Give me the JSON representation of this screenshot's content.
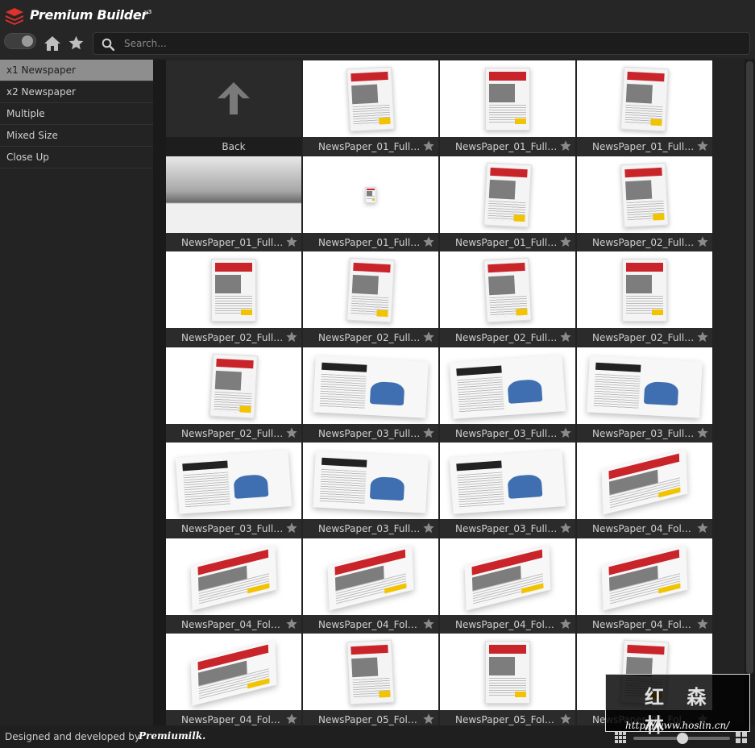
{
  "header": {
    "brand": "Premium Builder",
    "version": "v3"
  },
  "toolbar": {
    "search_placeholder": "Search..."
  },
  "sidebar": {
    "items": [
      {
        "label": "x1 Newspaper",
        "active": true
      },
      {
        "label": "x2 Newspaper",
        "active": false
      },
      {
        "label": "Multiple",
        "active": false
      },
      {
        "label": "Mixed Size",
        "active": false
      },
      {
        "label": "Close Up",
        "active": false
      }
    ]
  },
  "grid": {
    "back_label": "Back",
    "tiles": [
      {
        "label": "NewsPaper_01_FullP...",
        "style": "np"
      },
      {
        "label": "NewsPaper_01_FullP...",
        "style": "np"
      },
      {
        "label": "NewsPaper_01_FullP...",
        "style": "np"
      },
      {
        "label": "NewsPaper_01_FullP...",
        "style": "closeup"
      },
      {
        "label": "NewsPaper_01_FullP...",
        "style": "tiny"
      },
      {
        "label": "NewsPaper_01_FullP...",
        "style": "np"
      },
      {
        "label": "NewsPaper_02_FullP...",
        "style": "np"
      },
      {
        "label": "NewsPaper_02_FullP...",
        "style": "np"
      },
      {
        "label": "NewsPaper_02_FullP...",
        "style": "np"
      },
      {
        "label": "NewsPaper_02_FullP...",
        "style": "np"
      },
      {
        "label": "NewsPaper_02_FullP...",
        "style": "np"
      },
      {
        "label": "NewsPaper_02_FullP...",
        "style": "np"
      },
      {
        "label": "NewsPaper_03_FullP...",
        "style": "mag"
      },
      {
        "label": "NewsPaper_03_FullP...",
        "style": "mag"
      },
      {
        "label": "NewsPaper_03_FullP...",
        "style": "mag"
      },
      {
        "label": "NewsPaper_03_FullP...",
        "style": "mag"
      },
      {
        "label": "NewsPaper_03_FullP...",
        "style": "mag"
      },
      {
        "label": "NewsPaper_03_FullP...",
        "style": "mag"
      },
      {
        "label": "NewsPaper_04_Folde...",
        "style": "folded"
      },
      {
        "label": "NewsPaper_04_Folde...",
        "style": "folded"
      },
      {
        "label": "NewsPaper_04_Folde...",
        "style": "folded"
      },
      {
        "label": "NewsPaper_04_Folde...",
        "style": "folded"
      },
      {
        "label": "NewsPaper_04_Folde...",
        "style": "folded"
      },
      {
        "label": "NewsPaper_04_Folde...",
        "style": "folded"
      },
      {
        "label": "NewsPaper_05_Folde...",
        "style": "np"
      },
      {
        "label": "NewsPaper_05_Folde...",
        "style": "np"
      },
      {
        "label": "NewsPaper_05_Folde...",
        "style": "np"
      }
    ]
  },
  "footer": {
    "credit": "Designed and developed by",
    "signature": "Premiumilk."
  },
  "watermark": {
    "logo_text": "红 森 林",
    "url": "http://www.hoslin.cn/"
  },
  "colors": {
    "accent_red": "#c8242a",
    "accent_yellow": "#f2c400",
    "active_item": "#8e8e8e"
  },
  "icons": {
    "logo": "stacked-layers-icon",
    "home": "home-icon",
    "favorites": "star-icon",
    "search": "search-icon",
    "back": "arrow-up-icon",
    "favorite_tile": "star-icon"
  }
}
